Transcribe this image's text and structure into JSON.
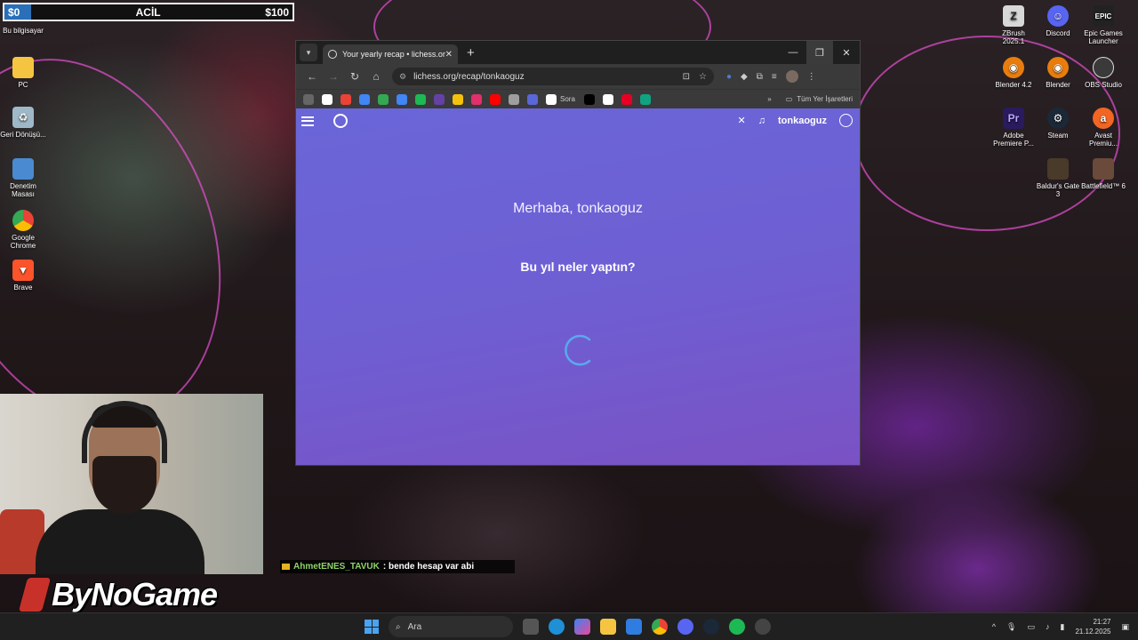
{
  "hud": {
    "money_left": "$0",
    "title": "ACİL",
    "money_right": "$100"
  },
  "desktop_left": [
    {
      "label": "Bu bilgisayar",
      "icon": "computer-icon"
    },
    {
      "label": "PC",
      "icon": "folder-icon"
    },
    {
      "label": "Geri Dönüşü...",
      "icon": "recycle-bin-icon"
    },
    {
      "label": "Denetim Masası",
      "icon": "control-panel-icon"
    },
    {
      "label": "Google Chrome",
      "icon": "chrome-icon"
    },
    {
      "label": "Brave",
      "icon": "brave-icon"
    }
  ],
  "desktop_right": [
    {
      "label": "ZBrush 2025.1",
      "icon": "zbrush-icon",
      "color": "#d8d8d8"
    },
    {
      "label": "Discord",
      "icon": "discord-icon",
      "color": "#5865f2"
    },
    {
      "label": "Epic Games Launcher",
      "icon": "epic-games-icon",
      "color": "#222222"
    },
    {
      "label": "Blender 4.2",
      "icon": "blender-icon",
      "color": "#e87d0d"
    },
    {
      "label": "Blender",
      "icon": "blender-icon",
      "color": "#e87d0d"
    },
    {
      "label": "OBS Studio",
      "icon": "obs-icon",
      "color": "#3a3a3a"
    },
    {
      "label": "Adobe Premiere P...",
      "icon": "premiere-icon",
      "color": "#2a1a5e"
    },
    {
      "label": "Steam",
      "icon": "steam-icon",
      "color": "#1b2838"
    },
    {
      "label": "Avast Premiu...",
      "icon": "avast-icon",
      "color": "#f26522"
    },
    {
      "label": "Baldur's Gate 3",
      "icon": "baldurs-gate-icon",
      "color": "#4a3a2a"
    },
    {
      "label": "Battlefield™ 6",
      "icon": "battlefield-icon",
      "color": "#6a4a3a"
    }
  ],
  "browser": {
    "tab_title": "Your yearly recap • lichess.org",
    "url": "lichess.org/recap/tonkaoguz",
    "bookmark_label": "Sora",
    "bookmarks_folder": "Tüm Yer İşaretleri",
    "bookmark_colors": [
      "#ffffff",
      "#ea4335",
      "#4285f4",
      "#34a853",
      "#4285f4",
      "#1db954",
      "#6441a5",
      "#f4c20d",
      "#e1306c",
      "#ff0000",
      "#9e9e9e",
      "#5a67d8",
      "#ffffff",
      "#000000",
      "#ffffff",
      "#e60023",
      "#10a37f"
    ]
  },
  "lichess": {
    "username": "tonkaoguz",
    "greeting": "Merhaba, tonkaoguz",
    "question": "Bu yıl neler yaptın?"
  },
  "chat": {
    "user": "AhmetENES_TAVUK",
    "message": ": bende hesap var abi"
  },
  "brand": "ByNoGame",
  "taskbar": {
    "search_placeholder": "Ara",
    "time": "21:27",
    "date": "21.12.2025"
  },
  "colors": {
    "lichess_gradient_start": "#6a66d8",
    "lichess_gradient_end": "#7a52c4",
    "accent": "#4aa3f0"
  }
}
